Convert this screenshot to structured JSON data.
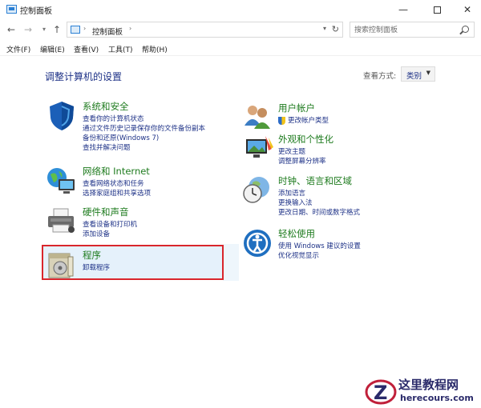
{
  "window": {
    "title": "控制面板"
  },
  "address": {
    "crumb": "控制面板"
  },
  "search": {
    "placeholder": "搜索控制面板"
  },
  "menu": [
    "文件(F)",
    "编辑(E)",
    "查看(V)",
    "工具(T)",
    "帮助(H)"
  ],
  "main": {
    "title": "调整计算机的设置",
    "view_by_label": "查看方式:",
    "view_by_value": "类别"
  },
  "categories": [
    {
      "heading": "系统和安全",
      "links": [
        "查看你的计算机状态",
        "通过文件历史记录保存你的文件备份副本",
        "备份和还原(Windows 7)",
        "查找并解决问题"
      ]
    },
    {
      "heading": "网络和 Internet",
      "links": [
        "查看网络状态和任务",
        "选择家庭组和共享选项"
      ]
    },
    {
      "heading": "硬件和声音",
      "links": [
        "查看设备和打印机",
        "添加设备"
      ]
    },
    {
      "heading": "程序",
      "links": [
        "卸载程序"
      ]
    },
    {
      "heading": "用户帐户",
      "links": [
        "更改帐户类型"
      ]
    },
    {
      "heading": "外观和个性化",
      "links": [
        "更改主题",
        "调整屏幕分辨率"
      ]
    },
    {
      "heading": "时钟、语言和区域",
      "links": [
        "添加语言",
        "更换输入法",
        "更改日期、时间或数字格式"
      ]
    },
    {
      "heading": "轻松使用",
      "links": [
        "使用 Windows 建议的设置",
        "优化视觉显示"
      ]
    }
  ],
  "watermark": {
    "title": "这里教程网",
    "url": "herecours.com"
  }
}
